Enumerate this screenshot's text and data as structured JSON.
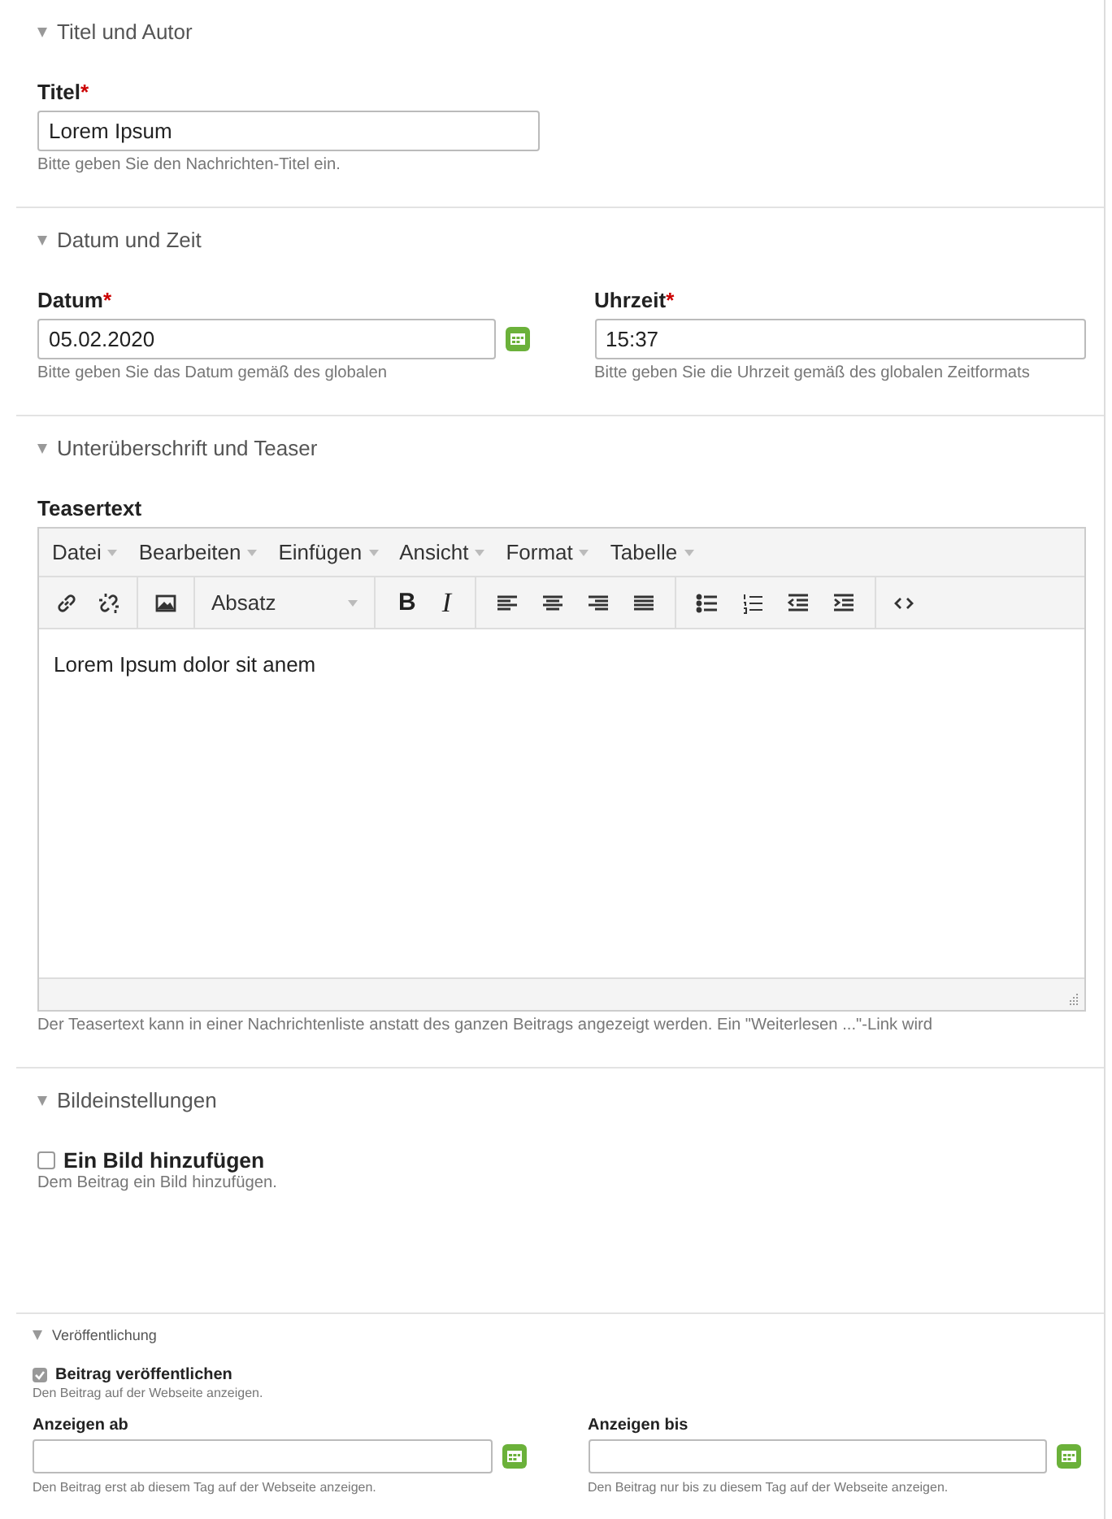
{
  "sections": [
    {
      "title": "Titel und Autor",
      "expanded": true,
      "rows": [
        [
          {
            "kind": "text",
            "label": "Titel",
            "required_mark": "*",
            "value": "Lorem Ipsum",
            "hint": "Bitte geben Sie den Nachrichten-Titel ein."
          }
        ]
      ]
    },
    {
      "title": "Datum und Zeit",
      "expanded": true,
      "rows": [
        [
          {
            "kind": "date",
            "label": "Datum",
            "required_mark": "*",
            "value": "05.02.2020",
            "hint": "Bitte geben Sie das Datum gemäß des globalen"
          },
          {
            "kind": "text",
            "label": "Uhrzeit",
            "required_mark": "*",
            "value": "15:37",
            "hint": "Bitte geben Sie die Uhrzeit gemäß des globalen Zeitformats"
          }
        ]
      ]
    },
    {
      "title": "Unterüberschrift und Teaser",
      "expanded": true,
      "rows": [
        [
          {
            "kind": "editor",
            "label": "Teasertext",
            "menus": [
              "Datei",
              "Bearbeiten",
              "Einfügen",
              "Ansicht",
              "Format",
              "Tabelle"
            ],
            "block_format": "Absatz",
            "bold": "B",
            "italic": "I",
            "value": "Lorem Ipsum dolor sit anem",
            "hint": "Der Teasertext kann in einer Nachrichtenliste anstatt des ganzen Beitrags angezeigt werden. Ein \"Weiterlesen ...\"-Link wird"
          }
        ]
      ]
    },
    {
      "title": "Bildeinstellungen",
      "expanded": true,
      "rows": [
        [
          {
            "kind": "checkbox",
            "label": "Ein Bild hinzufügen",
            "checked": false,
            "hint": "Dem Beitrag ein Bild hinzufügen."
          }
        ]
      ]
    },
    {
      "title": "Veröffentlichung",
      "expanded": true,
      "rows": [
        [
          {
            "kind": "checkbox",
            "label": "Beitrag veröffentlichen",
            "checked": true,
            "hint": "Den Beitrag auf der Webseite anzeigen."
          }
        ],
        [
          {
            "kind": "date",
            "label": "Anzeigen ab",
            "hint": "Den Beitrag erst ab diesem Tag auf der Webseite anzeigen."
          },
          {
            "kind": "date",
            "label": "Anzeigen bis",
            "hint": "Den Beitrag nur bis zu diesem Tag auf der Webseite anzeigen."
          }
        ]
      ]
    }
  ]
}
